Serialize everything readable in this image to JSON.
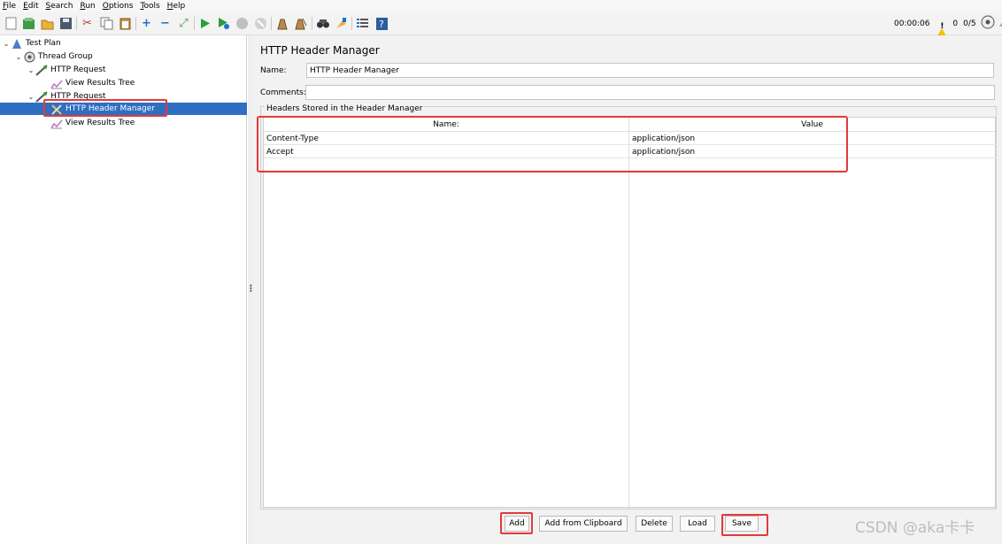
{
  "menu": [
    "File",
    "Edit",
    "Search",
    "Run",
    "Options",
    "Tools",
    "Help"
  ],
  "toolbar": {
    "icons": [
      "new-icon",
      "templates-icon",
      "open-icon",
      "save-icon",
      "cut-icon",
      "copy-icon",
      "paste-icon",
      "expand-icon",
      "collapse-icon",
      "toggle-icon",
      "start-icon",
      "start-no-pause-icon",
      "stop-icon",
      "shutdown-icon",
      "clear-icon",
      "clear-all-icon",
      "search-icon",
      "reset-search-icon",
      "function-helper-icon",
      "help-icon"
    ],
    "timer": "00:00:06",
    "warning_count": "0",
    "threads": "0/5",
    "colors": {
      "run_green": "#2a9d3a",
      "warn_yellow": "#f2c200"
    }
  },
  "tree": {
    "items": [
      {
        "label": "Test Plan",
        "icon": "test-plan-icon"
      },
      {
        "label": "Thread Group",
        "icon": "thread-group-icon"
      },
      {
        "label": "HTTP Request",
        "icon": "sampler-icon"
      },
      {
        "label": "View Results Tree",
        "icon": "listener-icon"
      },
      {
        "label": "HTTP Request",
        "icon": "sampler-icon"
      },
      {
        "label": "HTTP Header Manager",
        "icon": "config-icon",
        "selected": true
      },
      {
        "label": "View Results Tree",
        "icon": "listener-icon"
      }
    ],
    "selection_color": "#2f6fc1"
  },
  "panel": {
    "title": "HTTP Header Manager",
    "name_label": "Name:",
    "name_value": "HTTP Header Manager",
    "comments_label": "Comments:",
    "comments_value": "",
    "group_title": "Headers Stored in the Header Manager",
    "columns": [
      "Name:",
      "Value"
    ],
    "rows": [
      {
        "name": "Content-Type",
        "value": "application/json"
      },
      {
        "name": "Accept",
        "value": "application/json"
      }
    ],
    "buttons": {
      "add": "Add",
      "add_from_clipboard": "Add from Clipboard",
      "delete": "Delete",
      "load": "Load",
      "save": "Save"
    }
  },
  "annotation_color": "#e23a3a",
  "watermark": "CSDN @aka卡卡"
}
